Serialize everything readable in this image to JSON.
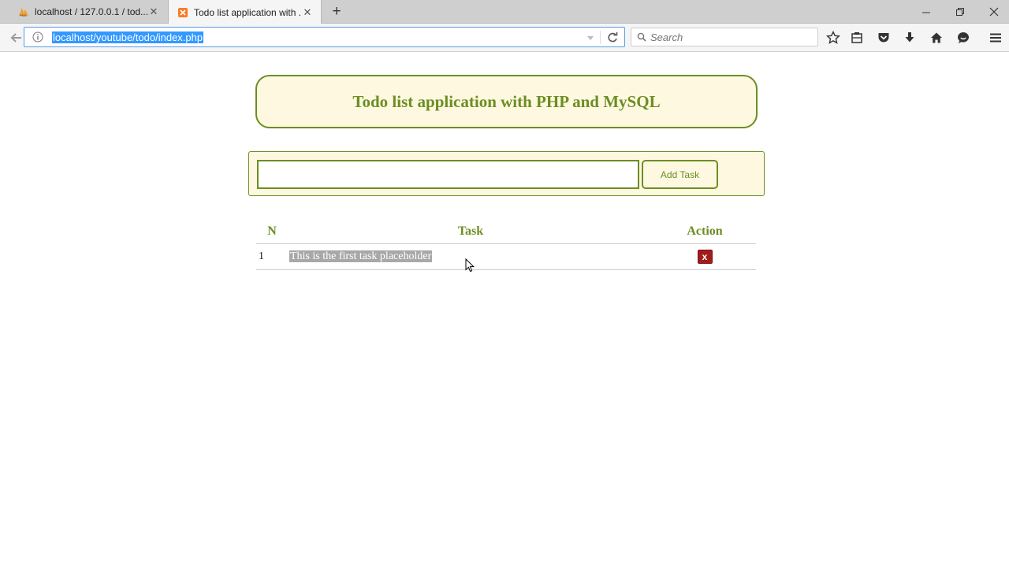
{
  "browser": {
    "tabs": [
      {
        "label": "localhost / 127.0.0.1 / tod...",
        "active": false,
        "icon": "phpmyadmin-icon"
      },
      {
        "label": "Todo list application with ...",
        "active": true,
        "icon": "xampp-icon"
      }
    ],
    "url": "localhost/youtube/todo/index.php",
    "search_placeholder": "Search"
  },
  "page": {
    "heading": "Todo list application with PHP and MySQL",
    "task_input_value": "",
    "add_button_label": "Add Task",
    "table": {
      "headers": {
        "n": "N",
        "task": "Task",
        "action": "Action"
      },
      "rows": [
        {
          "n": "1",
          "task": "This is the first task placeholder",
          "delete_label": "x"
        }
      ]
    }
  },
  "colors": {
    "accent": "#6b8e23",
    "panel_bg": "#fff8e0",
    "delete_bg": "#a11c1c",
    "url_highlight": "#3399ff"
  }
}
